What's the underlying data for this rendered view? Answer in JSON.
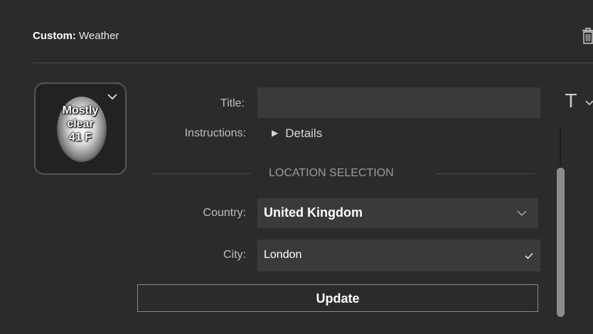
{
  "header": {
    "prefix": "Custom:",
    "name": "Weather"
  },
  "icons": {
    "delete": "trash-icon",
    "expand": "chevron-down-icon",
    "text_format": "text-format-icon",
    "check": "check-icon"
  },
  "preview": {
    "line1": "Mostly",
    "line2": "clear",
    "line3": "41 F"
  },
  "form": {
    "title_label": "Title:",
    "title_value": "",
    "instructions_label": "Instructions:",
    "instructions_toggle": "Details",
    "section_title": "LOCATION SELECTION",
    "country_label": "Country:",
    "country_value": "United Kingdom",
    "city_label": "City:",
    "city_value": "London",
    "update_label": "Update"
  },
  "right_panel": {
    "text_tool": "T"
  },
  "colors": {
    "background": "#2b2b2b",
    "field": "#3a3a3a",
    "scroll_thumb": "#8c8c8c"
  }
}
